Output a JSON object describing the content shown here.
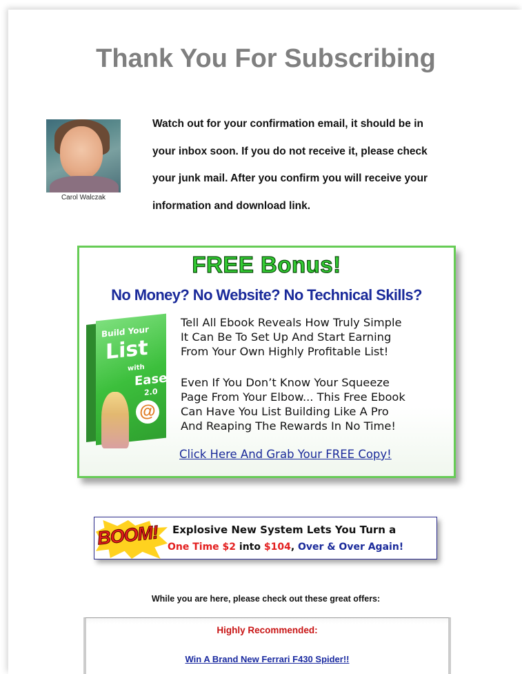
{
  "page": {
    "title": "Thank You For Subscribing"
  },
  "author": {
    "name": "Carol Walczak",
    "intro_lines": [
      "Watch out for your confirmation email, it should be in",
      "your inbox soon. If you do not receive it, please check",
      "your junk mail. After you confirm you will receive your",
      "information and download link."
    ]
  },
  "bonus": {
    "heading": "FREE Bonus!",
    "subheading": "No Money? No Website? No Technical Skills?",
    "ebook_cover": {
      "line1": "Build Your",
      "line2": "List",
      "line3": "with",
      "line4": "Ease",
      "version": "2.0"
    },
    "paragraph1": [
      "Tell All Ebook Reveals How Truly Simple",
      "It Can Be To Set Up And Start Earning",
      "From Your Own Highly Profitable List!"
    ],
    "paragraph2": [
      "Even If You Don’t Know Your Squeeze",
      "Page From Your Elbow... This Free Ebook",
      "Can Have You List Building Like A Pro",
      "And Reaping The Rewards In No Time!"
    ],
    "cta_link": "Click Here And Grab Your FREE Copy!",
    "border_color": "#66cc55"
  },
  "boom_banner": {
    "burst_text": "BOOM!",
    "line1": "Explosive New System Lets You Turn a",
    "line2_parts": [
      "One Time $2",
      " into ",
      "$104",
      ", ",
      "Over & Over Again!"
    ]
  },
  "offers": {
    "intro": "While you are here, please check out these great offers:",
    "heading": "Highly Recommended:",
    "link": "Win A Brand New Ferrari F430 Spider!!"
  },
  "colors": {
    "title_gray": "#7f7f7f",
    "link_blue": "#1a2a9a",
    "accent_red": "#e31e1e",
    "bonus_green": "#33cc33"
  }
}
